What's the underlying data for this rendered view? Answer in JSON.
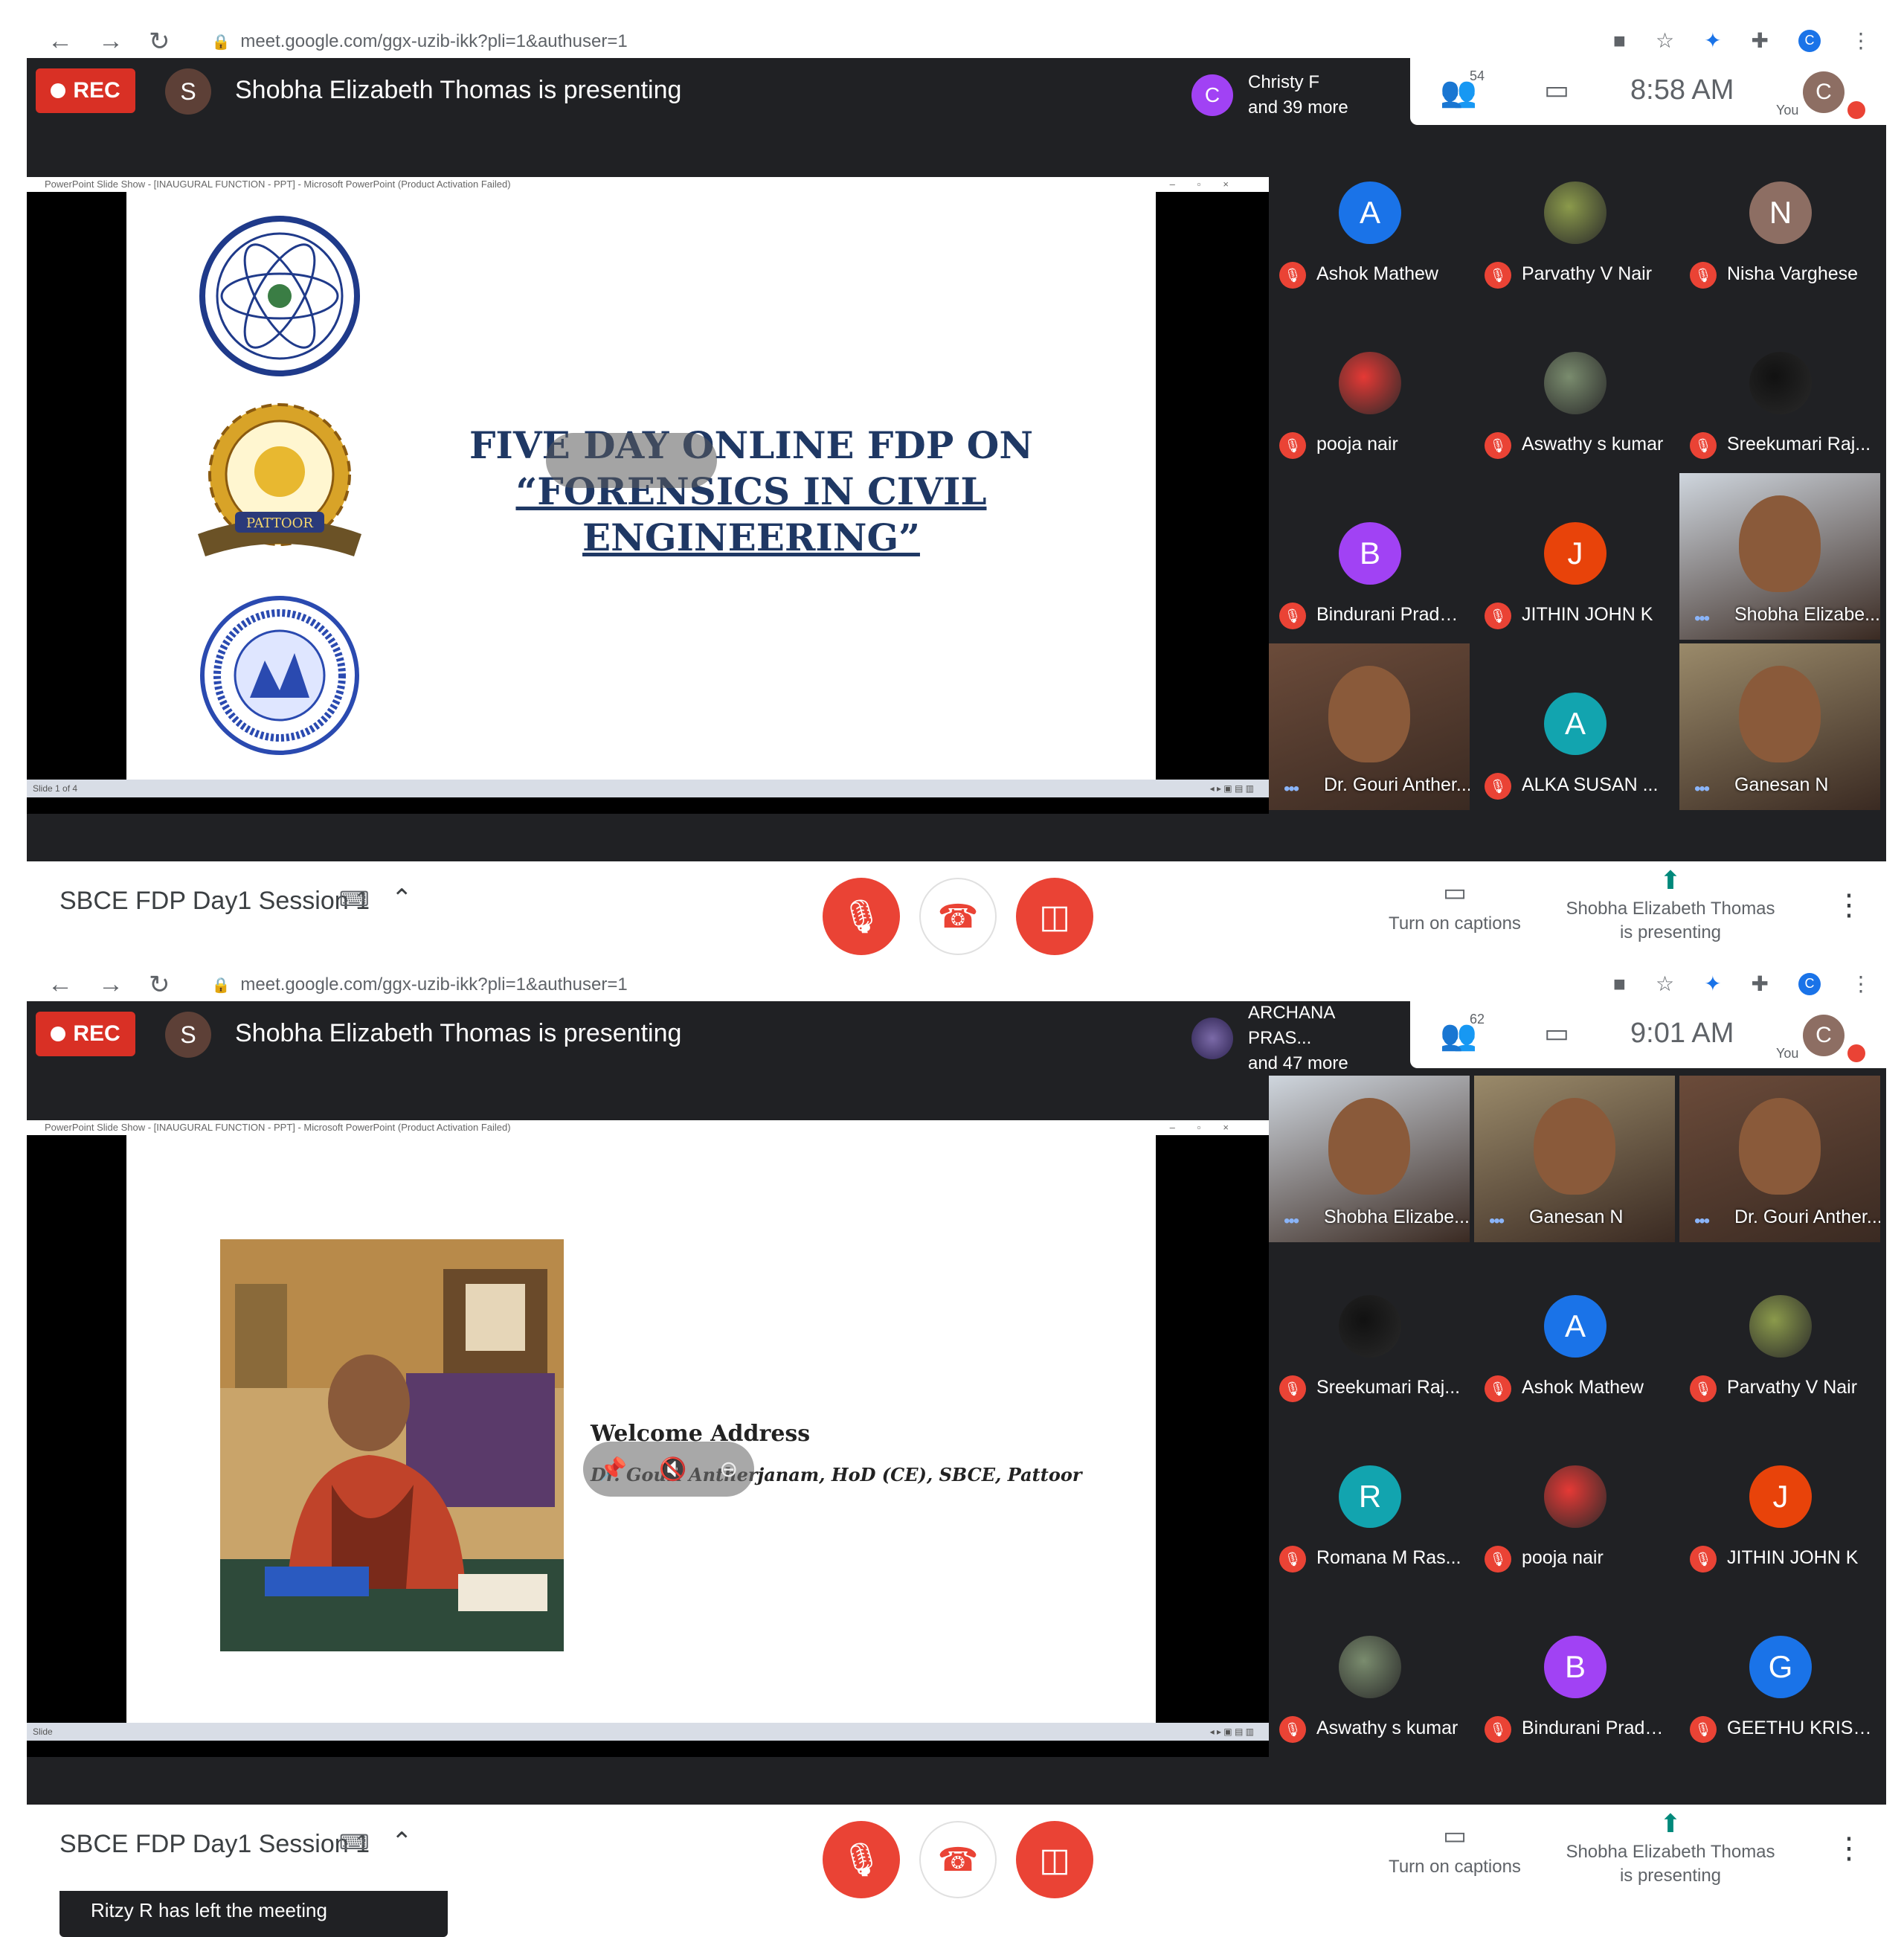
{
  "screenshots": [
    {
      "browser": {
        "url": "meet.google.com/ggx-uzib-ikk?pli=1&authuser=1",
        "profile_initial": "C"
      },
      "rec_label": "REC",
      "presenter": {
        "initial": "S",
        "text": "Shobha Elizabeth Thomas is presenting"
      },
      "joined": {
        "initial": "C",
        "name": "Christy F",
        "more": "and 39 more"
      },
      "people_count": "54",
      "time": "8:58 AM",
      "you_label": "You",
      "me_initial": "C",
      "ppt_window_title": "PowerPoint Slide Show - [INAUGURAL FUNCTION - PPT] - Microsoft PowerPoint (Product Activation Failed)",
      "ppt_status": "Slide 1 of 4",
      "slide": {
        "title_line1": "FIVE DAY ONLINE FDP ON",
        "title_line2": "“FORENSICS IN CIVIL ENGINEERING”",
        "logo2_text": "PATTOOR"
      },
      "participants": [
        {
          "name": "Ashok Mathew",
          "initial": "A",
          "color": "#1a73e8",
          "kind": "initial"
        },
        {
          "name": "Parvathy V Nair",
          "initial": "",
          "color": "#8b9a4b",
          "kind": "photo"
        },
        {
          "name": "Nisha Varghese",
          "initial": "N",
          "color": "#8d6e63",
          "kind": "initial"
        },
        {
          "name": "pooja nair",
          "initial": "",
          "color": "#e53935",
          "kind": "photo"
        },
        {
          "name": "Aswathy s kumar",
          "initial": "",
          "color": "#7a8c6e",
          "kind": "photo"
        },
        {
          "name": "Sreekumari Raj...",
          "initial": "",
          "color": "#111111",
          "kind": "photo"
        },
        {
          "name": "Bindurani Prade...",
          "initial": "B",
          "color": "#a142f4",
          "kind": "initial"
        },
        {
          "name": "JITHIN JOHN K",
          "initial": "J",
          "color": "#e8430a",
          "kind": "initial"
        },
        {
          "name": "Shobha Elizabe...",
          "initial": "",
          "color": "#cfd6de",
          "kind": "video"
        },
        {
          "name": "Dr. Gouri Anther...",
          "initial": "",
          "color": "#6b4b3a",
          "kind": "video"
        },
        {
          "name": "ALKA SUSAN ...",
          "initial": "A",
          "color": "#12a4af",
          "kind": "initial"
        },
        {
          "name": "Ganesan N",
          "initial": "",
          "color": "#9a8a6a",
          "kind": "video"
        }
      ],
      "meeting_name": "SBCE FDP Day1 Session 1",
      "captions_label": "Turn on captions",
      "presenting_label": "Shobha Elizabeth Thomas is presenting"
    },
    {
      "browser": {
        "url": "meet.google.com/ggx-uzib-ikk?pli=1&authuser=1",
        "profile_initial": "C"
      },
      "rec_label": "REC",
      "presenter": {
        "initial": "S",
        "text": "Shobha Elizabeth Thomas is presenting"
      },
      "joined": {
        "initial": "",
        "name": "ARCHANA PRAS...",
        "more": "and 47 more"
      },
      "people_count": "62",
      "time": "9:01 AM",
      "you_label": "You",
      "me_initial": "C",
      "ppt_window_title": "PowerPoint Slide Show - [INAUGURAL FUNCTION - PPT] - Microsoft PowerPoint (Product Activation Failed)",
      "ppt_status": "Slide",
      "slide": {
        "welcome": "Welcome Address",
        "speaker": "Dr. Gouri Antherjanam, HoD (CE), SBCE, Pattoor"
      },
      "participants": [
        {
          "name": "Shobha Elizabe...",
          "initial": "",
          "color": "#cfd6de",
          "kind": "video"
        },
        {
          "name": "Ganesan N",
          "initial": "",
          "color": "#9a8a6a",
          "kind": "video"
        },
        {
          "name": "Dr. Gouri Anther...",
          "initial": "",
          "color": "#6b4b3a",
          "kind": "video"
        },
        {
          "name": "Sreekumari Raj...",
          "initial": "",
          "color": "#111111",
          "kind": "photo"
        },
        {
          "name": "Ashok Mathew",
          "initial": "A",
          "color": "#1a73e8",
          "kind": "initial"
        },
        {
          "name": "Parvathy V Nair",
          "initial": "",
          "color": "#8b9a4b",
          "kind": "photo"
        },
        {
          "name": "Romana M Ras...",
          "initial": "R",
          "color": "#12a4af",
          "kind": "initial"
        },
        {
          "name": "pooja nair",
          "initial": "",
          "color": "#e53935",
          "kind": "photo"
        },
        {
          "name": "JITHIN JOHN K",
          "initial": "J",
          "color": "#e8430a",
          "kind": "initial"
        },
        {
          "name": "Aswathy s kumar",
          "initial": "",
          "color": "#7a8c6e",
          "kind": "photo"
        },
        {
          "name": "Bindurani Prade...",
          "initial": "B",
          "color": "#a142f4",
          "kind": "initial"
        },
        {
          "name": "GEETHU KRISH...",
          "initial": "G",
          "color": "#1a73e8",
          "kind": "initial"
        }
      ],
      "toast": "Ritzy R has left the meeting",
      "meeting_name": "SBCE FDP Day1 Session 1",
      "captions_label": "Turn on captions",
      "presenting_label": "Shobha Elizabeth Thomas is presenting"
    }
  ]
}
